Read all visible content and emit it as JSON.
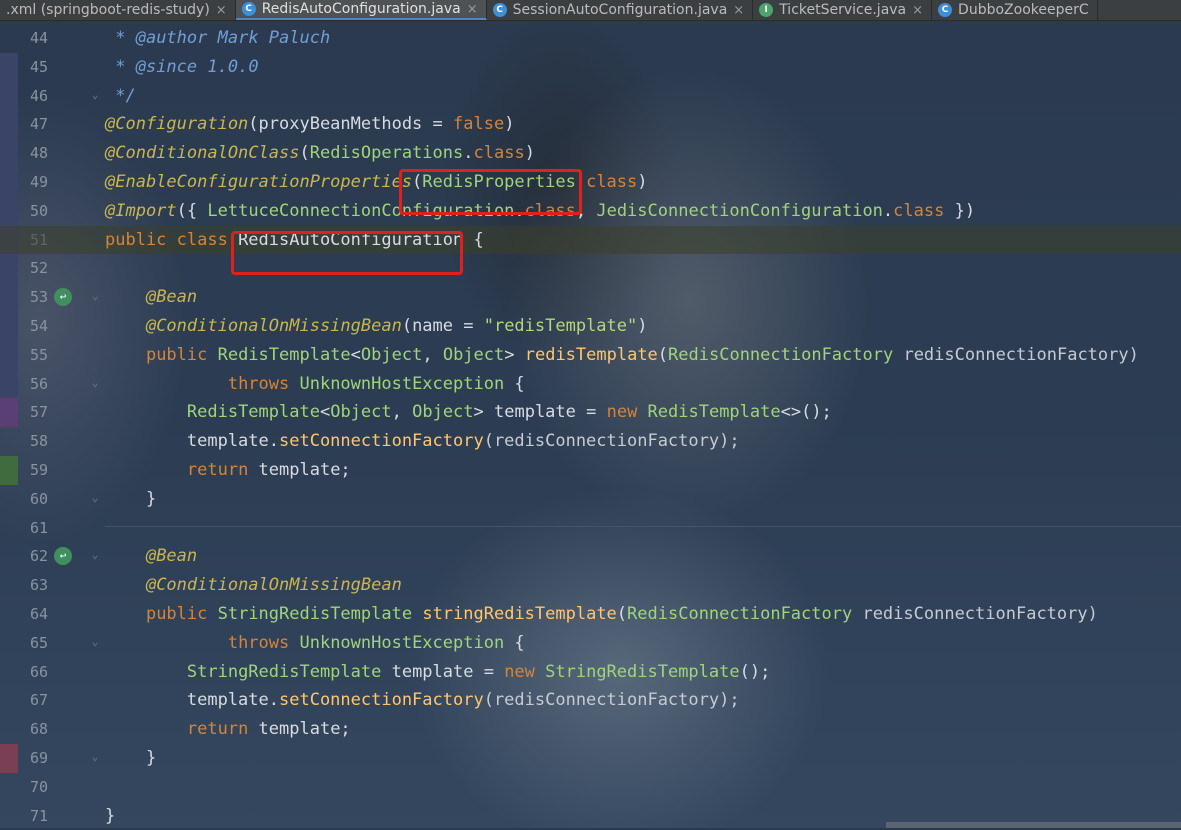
{
  "tabs": [
    {
      "label": ".xml (springboot-redis-study)",
      "icon": "",
      "close": "×",
      "active": false
    },
    {
      "label": "RedisAutoConfiguration.java",
      "icon": "C",
      "close": "×",
      "active": true
    },
    {
      "label": "SessionAutoConfiguration.java",
      "icon": "C",
      "close": "×",
      "active": false
    },
    {
      "label": "TicketService.java",
      "icon": "I",
      "close": "×",
      "active": false
    },
    {
      "label": "DubboZookeeperC",
      "icon": "C",
      "close": "",
      "active": false
    }
  ],
  "line_numbers": [
    "44",
    "45",
    "46",
    "47",
    "48",
    "49",
    "50",
    "51",
    "52",
    "53",
    "54",
    "55",
    "56",
    "57",
    "58",
    "59",
    "60",
    "61",
    "62",
    "63",
    "64",
    "65",
    "66",
    "67",
    "68",
    "69",
    "70",
    "71"
  ],
  "code_lines": [
    [
      {
        "t": " * ",
        "c": "doc"
      },
      {
        "t": "@author",
        "c": "doc"
      },
      {
        "t": " Mark Paluch",
        "c": "doc"
      }
    ],
    [
      {
        "t": " * ",
        "c": "doc"
      },
      {
        "t": "@since",
        "c": "doc"
      },
      {
        "t": " 1.0.0",
        "c": "doc"
      }
    ],
    [
      {
        "t": " */",
        "c": "doc"
      }
    ],
    [
      {
        "t": "@Configuration",
        "c": "ann"
      },
      {
        "t": "(proxyBeanMethods = ",
        "c": ""
      },
      {
        "t": "false",
        "c": "kw"
      },
      {
        "t": ")",
        "c": ""
      }
    ],
    [
      {
        "t": "@ConditionalOnClass",
        "c": "ann"
      },
      {
        "t": "(",
        "c": ""
      },
      {
        "t": "RedisOperations",
        "c": "cls"
      },
      {
        "t": ".",
        "c": ""
      },
      {
        "t": "class",
        "c": "kw"
      },
      {
        "t": ")",
        "c": ""
      }
    ],
    [
      {
        "t": "@EnableConfigurationProperties",
        "c": "ann"
      },
      {
        "t": "(",
        "c": ""
      },
      {
        "t": "RedisProperties",
        "c": "cls"
      },
      {
        "t": ".",
        "c": ""
      },
      {
        "t": "class",
        "c": "kw"
      },
      {
        "t": ")",
        "c": ""
      }
    ],
    [
      {
        "t": "@Import",
        "c": "ann"
      },
      {
        "t": "({ ",
        "c": ""
      },
      {
        "t": "LettuceConnectionConfiguration",
        "c": "cls"
      },
      {
        "t": ".",
        "c": ""
      },
      {
        "t": "class",
        "c": "kw"
      },
      {
        "t": ", ",
        "c": ""
      },
      {
        "t": "JedisConnectionConfiguration",
        "c": "cls"
      },
      {
        "t": ".",
        "c": ""
      },
      {
        "t": "class",
        "c": "kw"
      },
      {
        "t": " })",
        "c": ""
      }
    ],
    [
      {
        "t": "public class ",
        "c": "kw"
      },
      {
        "t": "RedisAutoConfiguration",
        "c": ""
      },
      {
        "t": " {",
        "c": ""
      }
    ],
    [],
    [
      {
        "t": "    ",
        "c": ""
      },
      {
        "t": "@Bean",
        "c": "ann"
      }
    ],
    [
      {
        "t": "    ",
        "c": ""
      },
      {
        "t": "@ConditionalOnMissingBean",
        "c": "ann"
      },
      {
        "t": "(name = ",
        "c": ""
      },
      {
        "t": "\"redisTemplate\"",
        "c": "str"
      },
      {
        "t": ")",
        "c": ""
      }
    ],
    [
      {
        "t": "    ",
        "c": ""
      },
      {
        "t": "public ",
        "c": "kw"
      },
      {
        "t": "RedisTemplate",
        "c": "cls"
      },
      {
        "t": "<",
        "c": ""
      },
      {
        "t": "Object",
        "c": "cls"
      },
      {
        "t": ", ",
        "c": ""
      },
      {
        "t": "Object",
        "c": "cls"
      },
      {
        "t": "> ",
        "c": ""
      },
      {
        "t": "redisTemplate",
        "c": "fn"
      },
      {
        "t": "(",
        "c": ""
      },
      {
        "t": "RedisConnectionFactory",
        "c": "cls"
      },
      {
        "t": " redisConnectionFactory)",
        "c": "param"
      }
    ],
    [
      {
        "t": "            ",
        "c": ""
      },
      {
        "t": "throws ",
        "c": "kw"
      },
      {
        "t": "UnknownHostException",
        "c": "cls"
      },
      {
        "t": " {",
        "c": ""
      }
    ],
    [
      {
        "t": "        ",
        "c": ""
      },
      {
        "t": "RedisTemplate",
        "c": "cls"
      },
      {
        "t": "<",
        "c": ""
      },
      {
        "t": "Object",
        "c": "cls"
      },
      {
        "t": ", ",
        "c": ""
      },
      {
        "t": "Object",
        "c": "cls"
      },
      {
        "t": "> template = ",
        "c": ""
      },
      {
        "t": "new ",
        "c": "kw"
      },
      {
        "t": "RedisTemplate",
        "c": "cls"
      },
      {
        "t": "<>();",
        "c": ""
      }
    ],
    [
      {
        "t": "        template.",
        "c": ""
      },
      {
        "t": "setConnectionFactory",
        "c": "fn"
      },
      {
        "t": "(redisConnectionFactory);",
        "c": "param"
      }
    ],
    [
      {
        "t": "        ",
        "c": ""
      },
      {
        "t": "return ",
        "c": "kw"
      },
      {
        "t": "template;",
        "c": ""
      }
    ],
    [
      {
        "t": "    }",
        "c": ""
      }
    ],
    [],
    [
      {
        "t": "    ",
        "c": ""
      },
      {
        "t": "@Bean",
        "c": "ann"
      }
    ],
    [
      {
        "t": "    ",
        "c": ""
      },
      {
        "t": "@ConditionalOnMissingBean",
        "c": "ann"
      }
    ],
    [
      {
        "t": "    ",
        "c": ""
      },
      {
        "t": "public ",
        "c": "kw"
      },
      {
        "t": "StringRedisTemplate",
        "c": "cls"
      },
      {
        "t": " ",
        "c": ""
      },
      {
        "t": "stringRedisTemplate",
        "c": "fn"
      },
      {
        "t": "(",
        "c": ""
      },
      {
        "t": "RedisConnectionFactory",
        "c": "cls"
      },
      {
        "t": " redisConnectionFactory)",
        "c": "param"
      }
    ],
    [
      {
        "t": "            ",
        "c": ""
      },
      {
        "t": "throws ",
        "c": "kw"
      },
      {
        "t": "UnknownHostException",
        "c": "cls"
      },
      {
        "t": " {",
        "c": ""
      }
    ],
    [
      {
        "t": "        ",
        "c": ""
      },
      {
        "t": "StringRedisTemplate",
        "c": "cls"
      },
      {
        "t": " template = ",
        "c": ""
      },
      {
        "t": "new ",
        "c": "kw"
      },
      {
        "t": "StringRedisTemplate",
        "c": "cls"
      },
      {
        "t": "();",
        "c": ""
      }
    ],
    [
      {
        "t": "        template.",
        "c": ""
      },
      {
        "t": "setConnectionFactory",
        "c": "fn"
      },
      {
        "t": "(redisConnectionFactory);",
        "c": "param"
      }
    ],
    [
      {
        "t": "        ",
        "c": ""
      },
      {
        "t": "return ",
        "c": "kw"
      },
      {
        "t": "template;",
        "c": ""
      }
    ],
    [
      {
        "t": "    }",
        "c": ""
      }
    ],
    [],
    [
      {
        "t": "}",
        "c": ""
      }
    ]
  ],
  "colors": {
    "highlight_box": "#e0201c",
    "keyword": "#d4843a",
    "annotation": "#c9b64f",
    "class": "#9fd57a"
  }
}
